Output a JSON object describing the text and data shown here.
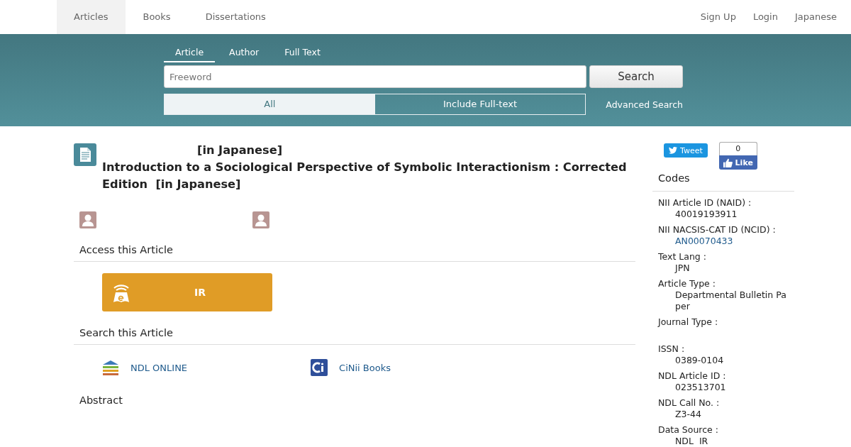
{
  "nav": {
    "items": [
      {
        "label": "Articles",
        "selected": true
      },
      {
        "label": "Books",
        "selected": false
      },
      {
        "label": "Dissertations",
        "selected": false
      }
    ],
    "right": [
      "Sign Up",
      "Login",
      "Japanese"
    ]
  },
  "search": {
    "tabs": [
      {
        "label": "Article",
        "selected": true
      },
      {
        "label": "Author",
        "selected": false
      },
      {
        "label": "Full Text",
        "selected": false
      }
    ],
    "placeholder": "Freeword",
    "button": "Search",
    "scopes": [
      {
        "label": "All",
        "selected": true
      },
      {
        "label": "Include Full-text",
        "selected": false
      }
    ],
    "advanced": "Advanced Search"
  },
  "article": {
    "title_line": "[in Japanese]",
    "title": "Introduction to a Sociological Perspective of Symbolic Interactionism : Corrected Edition  [in Japanese]",
    "authors": [
      {
        "kind": "person"
      },
      {
        "kind": "person"
      }
    ],
    "access_heading": "Access this Article",
    "access_button": "IR",
    "search_heading": "Search this Article",
    "search_links": [
      {
        "label": "NDL ONLINE",
        "kind": "ndl"
      },
      {
        "label": "CiNii Books",
        "kind": "cinii"
      }
    ],
    "abstract_heading": "Abstract"
  },
  "social": {
    "tweet": "Tweet",
    "like_count": "0",
    "like": "Like"
  },
  "codes": {
    "heading": "Codes",
    "rows": [
      {
        "label": "NII Article ID (NAID) :",
        "value": "40019193911",
        "kind": "text"
      },
      {
        "label": "NII NACSIS-CAT ID (NCID) :",
        "value": "AN00070433",
        "kind": "link"
      },
      {
        "label": "Text Lang :",
        "value": "JPN",
        "kind": "text"
      },
      {
        "label": "Article Type :",
        "value": "Departmental Bulletin Paper",
        "kind": "text"
      },
      {
        "label": "Journal Type :",
        "kind": "empty"
      },
      {
        "label": "ISSN :",
        "value": "0389-0104",
        "kind": "text"
      },
      {
        "label": "NDL Article ID :",
        "value": "023513701",
        "kind": "text"
      },
      {
        "label": "NDL Call No. :",
        "value": "Z3-44",
        "kind": "text"
      },
      {
        "label": "Data Source :",
        "value": "NDL  IR",
        "kind": "text"
      }
    ]
  }
}
